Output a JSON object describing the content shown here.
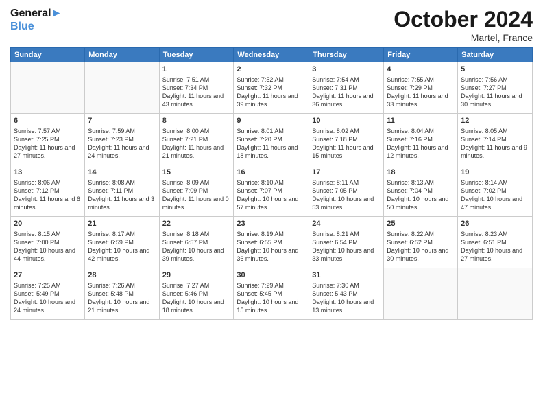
{
  "header": {
    "logo_line1": "General",
    "logo_line2": "Blue",
    "month": "October 2024",
    "location": "Martel, France"
  },
  "days_of_week": [
    "Sunday",
    "Monday",
    "Tuesday",
    "Wednesday",
    "Thursday",
    "Friday",
    "Saturday"
  ],
  "weeks": [
    [
      {
        "day": "",
        "info": ""
      },
      {
        "day": "",
        "info": ""
      },
      {
        "day": "1",
        "info": "Sunrise: 7:51 AM\nSunset: 7:34 PM\nDaylight: 11 hours and 43 minutes."
      },
      {
        "day": "2",
        "info": "Sunrise: 7:52 AM\nSunset: 7:32 PM\nDaylight: 11 hours and 39 minutes."
      },
      {
        "day": "3",
        "info": "Sunrise: 7:54 AM\nSunset: 7:31 PM\nDaylight: 11 hours and 36 minutes."
      },
      {
        "day": "4",
        "info": "Sunrise: 7:55 AM\nSunset: 7:29 PM\nDaylight: 11 hours and 33 minutes."
      },
      {
        "day": "5",
        "info": "Sunrise: 7:56 AM\nSunset: 7:27 PM\nDaylight: 11 hours and 30 minutes."
      }
    ],
    [
      {
        "day": "6",
        "info": "Sunrise: 7:57 AM\nSunset: 7:25 PM\nDaylight: 11 hours and 27 minutes."
      },
      {
        "day": "7",
        "info": "Sunrise: 7:59 AM\nSunset: 7:23 PM\nDaylight: 11 hours and 24 minutes."
      },
      {
        "day": "8",
        "info": "Sunrise: 8:00 AM\nSunset: 7:21 PM\nDaylight: 11 hours and 21 minutes."
      },
      {
        "day": "9",
        "info": "Sunrise: 8:01 AM\nSunset: 7:20 PM\nDaylight: 11 hours and 18 minutes."
      },
      {
        "day": "10",
        "info": "Sunrise: 8:02 AM\nSunset: 7:18 PM\nDaylight: 11 hours and 15 minutes."
      },
      {
        "day": "11",
        "info": "Sunrise: 8:04 AM\nSunset: 7:16 PM\nDaylight: 11 hours and 12 minutes."
      },
      {
        "day": "12",
        "info": "Sunrise: 8:05 AM\nSunset: 7:14 PM\nDaylight: 11 hours and 9 minutes."
      }
    ],
    [
      {
        "day": "13",
        "info": "Sunrise: 8:06 AM\nSunset: 7:12 PM\nDaylight: 11 hours and 6 minutes."
      },
      {
        "day": "14",
        "info": "Sunrise: 8:08 AM\nSunset: 7:11 PM\nDaylight: 11 hours and 3 minutes."
      },
      {
        "day": "15",
        "info": "Sunrise: 8:09 AM\nSunset: 7:09 PM\nDaylight: 11 hours and 0 minutes."
      },
      {
        "day": "16",
        "info": "Sunrise: 8:10 AM\nSunset: 7:07 PM\nDaylight: 10 hours and 57 minutes."
      },
      {
        "day": "17",
        "info": "Sunrise: 8:11 AM\nSunset: 7:05 PM\nDaylight: 10 hours and 53 minutes."
      },
      {
        "day": "18",
        "info": "Sunrise: 8:13 AM\nSunset: 7:04 PM\nDaylight: 10 hours and 50 minutes."
      },
      {
        "day": "19",
        "info": "Sunrise: 8:14 AM\nSunset: 7:02 PM\nDaylight: 10 hours and 47 minutes."
      }
    ],
    [
      {
        "day": "20",
        "info": "Sunrise: 8:15 AM\nSunset: 7:00 PM\nDaylight: 10 hours and 44 minutes."
      },
      {
        "day": "21",
        "info": "Sunrise: 8:17 AM\nSunset: 6:59 PM\nDaylight: 10 hours and 42 minutes."
      },
      {
        "day": "22",
        "info": "Sunrise: 8:18 AM\nSunset: 6:57 PM\nDaylight: 10 hours and 39 minutes."
      },
      {
        "day": "23",
        "info": "Sunrise: 8:19 AM\nSunset: 6:55 PM\nDaylight: 10 hours and 36 minutes."
      },
      {
        "day": "24",
        "info": "Sunrise: 8:21 AM\nSunset: 6:54 PM\nDaylight: 10 hours and 33 minutes."
      },
      {
        "day": "25",
        "info": "Sunrise: 8:22 AM\nSunset: 6:52 PM\nDaylight: 10 hours and 30 minutes."
      },
      {
        "day": "26",
        "info": "Sunrise: 8:23 AM\nSunset: 6:51 PM\nDaylight: 10 hours and 27 minutes."
      }
    ],
    [
      {
        "day": "27",
        "info": "Sunrise: 7:25 AM\nSunset: 5:49 PM\nDaylight: 10 hours and 24 minutes."
      },
      {
        "day": "28",
        "info": "Sunrise: 7:26 AM\nSunset: 5:48 PM\nDaylight: 10 hours and 21 minutes."
      },
      {
        "day": "29",
        "info": "Sunrise: 7:27 AM\nSunset: 5:46 PM\nDaylight: 10 hours and 18 minutes."
      },
      {
        "day": "30",
        "info": "Sunrise: 7:29 AM\nSunset: 5:45 PM\nDaylight: 10 hours and 15 minutes."
      },
      {
        "day": "31",
        "info": "Sunrise: 7:30 AM\nSunset: 5:43 PM\nDaylight: 10 hours and 13 minutes."
      },
      {
        "day": "",
        "info": ""
      },
      {
        "day": "",
        "info": ""
      }
    ]
  ]
}
